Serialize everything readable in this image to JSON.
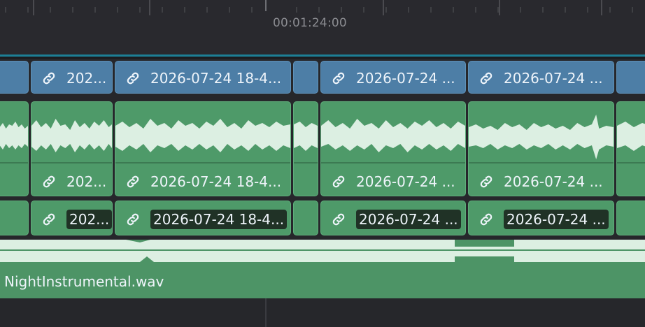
{
  "ruler": {
    "timecode": "00:01:24:00"
  },
  "video_track": {
    "clips": [
      {
        "label": ""
      },
      {
        "label": "202..."
      },
      {
        "label": "2026-07-24 18-4..."
      },
      {
        "label": ""
      },
      {
        "label": "2026-07-24 ..."
      },
      {
        "label": "2026-07-24 ..."
      },
      {
        "label": ""
      }
    ]
  },
  "audio_track_1": {
    "clips": [
      {
        "label": ""
      },
      {
        "label": "202..."
      },
      {
        "label": "2026-07-24 18-4..."
      },
      {
        "label": ""
      },
      {
        "label": "2026-07-24 ..."
      },
      {
        "label": "2026-07-24 ..."
      },
      {
        "label": ""
      }
    ]
  },
  "audio_track_2": {
    "clips": [
      {
        "label": ""
      },
      {
        "label": "202..."
      },
      {
        "label": "2026-07-24 18-4..."
      },
      {
        "label": ""
      },
      {
        "label": "2026-07-24 ..."
      },
      {
        "label": "2026-07-24 ..."
      },
      {
        "label": ""
      }
    ]
  },
  "music_track": {
    "label": "NightInstrumental.wav"
  },
  "icons": {
    "link": "link-icon"
  },
  "colors": {
    "video_clip": "#4d7ea6",
    "audio_clip": "#4e9a69",
    "accent_line": "#1d7f96"
  }
}
